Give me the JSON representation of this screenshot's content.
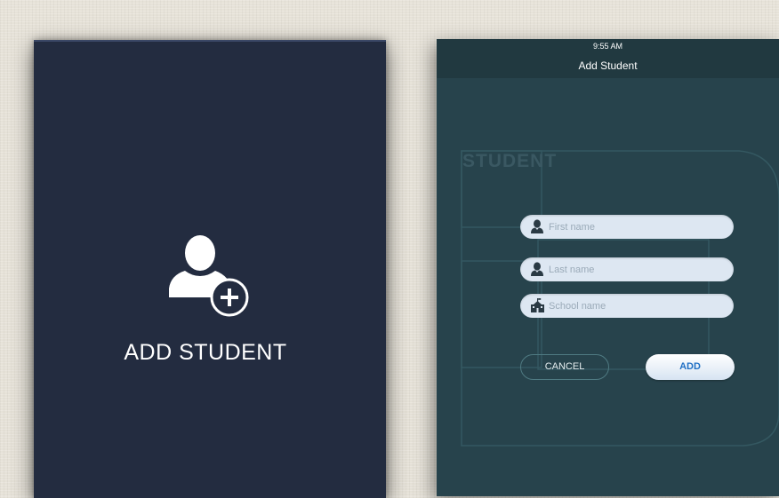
{
  "left_panel": {
    "icon": "add-user-icon",
    "label": "ADD STUDENT"
  },
  "right_panel": {
    "status_time": "9:55 AM",
    "nav_title": "Add Student",
    "watermark": "STUDENT",
    "fields": {
      "first_name": {
        "placeholder": "First name",
        "value": "",
        "icon": "user-icon"
      },
      "last_name": {
        "placeholder": "Last name",
        "value": "",
        "icon": "user-icon"
      },
      "school_name": {
        "placeholder": "School name",
        "value": "",
        "icon": "school-icon"
      }
    },
    "buttons": {
      "cancel": "CANCEL",
      "add": "ADD"
    }
  },
  "colors": {
    "left_bg": "#232c40",
    "right_bg": "#27434c",
    "field_bg": "#dde7f2",
    "add_text": "#1f6fc4"
  }
}
